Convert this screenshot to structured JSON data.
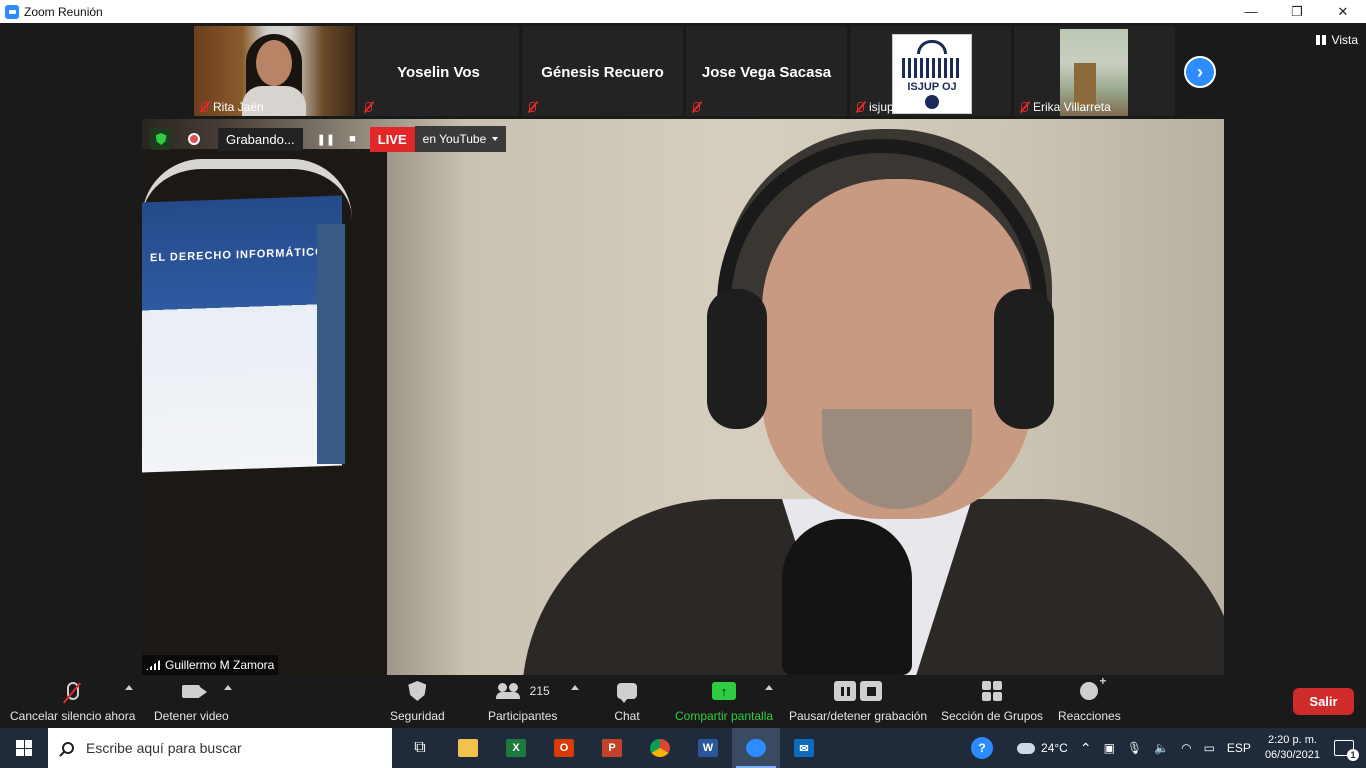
{
  "window": {
    "title": "Zoom Reunión",
    "controls": [
      "—",
      "❐",
      "✕"
    ]
  },
  "gallery": {
    "tiles": [
      {
        "kind": "video",
        "label": "Rita Jaén",
        "muted": true
      },
      {
        "kind": "name",
        "name": "Yoselin Vos",
        "muted": true
      },
      {
        "kind": "name",
        "name": "Génesis Recuero",
        "muted": true
      },
      {
        "kind": "name",
        "name": "Jose Vega Sacasa",
        "muted": true
      },
      {
        "kind": "logo",
        "label": "isjup oj",
        "logo_text": "ISJUP OJ",
        "muted": true
      },
      {
        "kind": "video",
        "label": "Erika Villarreta",
        "muted": true
      }
    ],
    "next_icon": "›",
    "view_label": "Vista"
  },
  "recording": {
    "status": "Grabando...",
    "live_label": "LIVE",
    "stream_target": "en YouTube",
    "pause_glyph": "❚❚",
    "stop_glyph": "■"
  },
  "main_video": {
    "speaker_name": "Guillermo M Zamora",
    "book_title": "EL DERECHO INFORMÁTICO"
  },
  "toolbar": {
    "mute_label": "Cancelar silencio ahora",
    "video_label": "Detener video",
    "security_label": "Seguridad",
    "participants_label": "Participantes",
    "participants_count": "215",
    "chat_label": "Chat",
    "share_label": "Compartir pantalla",
    "record_label": "Pausar/detener grabación",
    "groups_label": "Sección de Grupos",
    "reactions_label": "Reacciones",
    "leave_label": "Salir",
    "share_arrow": "↑"
  },
  "taskbar": {
    "search_placeholder": "Escribe aquí para buscar",
    "apps": [
      {
        "name": "task-view",
        "glyph": "⧉",
        "color": "#1f2a3a"
      },
      {
        "name": "file-explorer",
        "glyph": "",
        "color": "#f2c14e"
      },
      {
        "name": "excel",
        "glyph": "X",
        "color": "#1d7a3e"
      },
      {
        "name": "office",
        "glyph": "O",
        "color": "#d83b01"
      },
      {
        "name": "powerpoint",
        "glyph": "P",
        "color": "#c4432a"
      },
      {
        "name": "chrome",
        "glyph": "",
        "color": "#3a8a3a"
      },
      {
        "name": "word",
        "glyph": "W",
        "color": "#2b579a"
      },
      {
        "name": "zoom",
        "glyph": "",
        "color": "#2d8cff"
      },
      {
        "name": "mail",
        "glyph": "✉",
        "color": "#0f6cbd"
      }
    ],
    "weather": "24°C",
    "language": "ESP",
    "time": "2:20 p. m.",
    "date": "06/30/2021",
    "notifications": "1",
    "help_glyph": "?"
  }
}
